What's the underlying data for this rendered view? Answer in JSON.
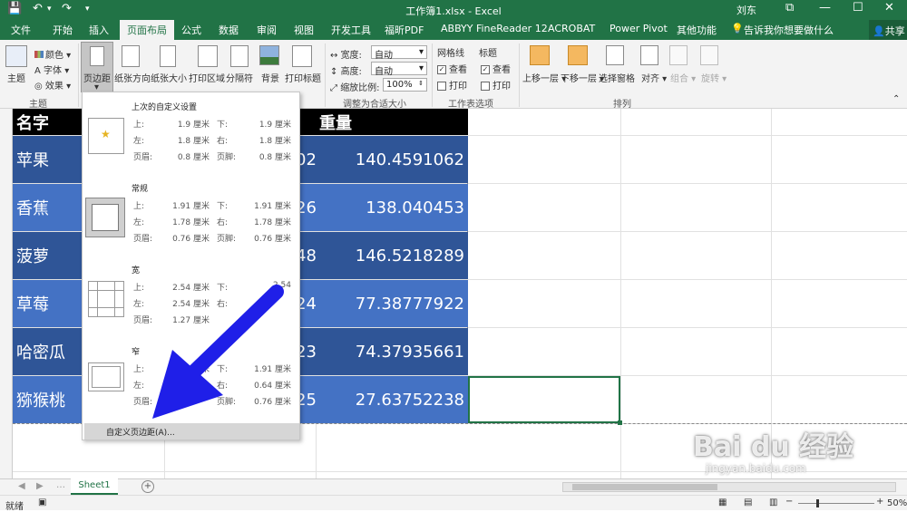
{
  "window": {
    "title": "工作簿1.xlsx - Excel",
    "user": "刘东",
    "share": "共享"
  },
  "qat": {
    "save": "💾",
    "undo": "↶",
    "undo_dd": "▾",
    "redo": "↷",
    "more": "▾"
  },
  "winctl": {
    "ribbon_opts": "⧉",
    "min": "—",
    "max": "☐",
    "close": "✕"
  },
  "tabs": [
    "文件",
    "开始",
    "插入",
    "页面布局",
    "公式",
    "数据",
    "审阅",
    "视图",
    "开发工具",
    "福昕PDF",
    "ABBYY FineReader 12",
    "ACROBAT",
    "Power Pivot",
    "其他功能"
  ],
  "tellme": "告诉我你想要做什么",
  "ribbon": {
    "theme_group": {
      "theme": "主题",
      "colors": "颜色",
      "fonts": "字体",
      "effects": "效果",
      "label": "主题"
    },
    "setup": {
      "margins": "页边距",
      "orientation": "纸张方向",
      "size": "纸张大小",
      "print_area": "打印区域",
      "breaks": "分隔符",
      "background": "背景",
      "print_titles": "打印标题"
    },
    "scale": {
      "width_label": "宽度:",
      "width_val": "自动",
      "height_label": "高度:",
      "height_val": "自动",
      "scale_label": "缩放比例:",
      "scale_val": "100%",
      "group": "调整为合适大小"
    },
    "sheet_opts": {
      "gridlines": "网格线",
      "headings": "标题",
      "view": "查看",
      "print": "打印",
      "group": "工作表选项"
    },
    "arrange": {
      "forward": "上移一层",
      "backward": "下移一层",
      "pane": "选择窗格",
      "align": "对齐",
      "group": "组合",
      "rotate": "旋转",
      "label": "排列"
    }
  },
  "table": {
    "header_name": "名字",
    "header_weight": "重量",
    "rows": [
      {
        "name": "苹果",
        "mid": "02",
        "weight": "140.4591062"
      },
      {
        "name": "香蕉",
        "mid": "26",
        "weight": "138.040453"
      },
      {
        "name": "菠萝",
        "mid": "48",
        "weight": "146.5218289"
      },
      {
        "name": "草莓",
        "mid": "24",
        "weight": "77.38777922"
      },
      {
        "name": "哈密瓜",
        "mid": "23",
        "weight": "74.37935661"
      },
      {
        "name": "猕猴桃",
        "mid": "25",
        "weight": "27.63752238"
      }
    ]
  },
  "menu": {
    "presets": [
      {
        "title": "上次的自定义设置",
        "top": "上:",
        "top_v": "1.9 厘米",
        "bottom": "下:",
        "bottom_v": "1.9 厘米",
        "left": "左:",
        "left_v": "1.8 厘米",
        "right": "右:",
        "right_v": "1.8 厘米",
        "header": "页眉:",
        "header_v": "0.8 厘米",
        "footer": "页脚:",
        "footer_v": "0.8 厘米"
      },
      {
        "title": "常规",
        "top": "上:",
        "top_v": "1.91 厘米",
        "bottom": "下:",
        "bottom_v": "1.91 厘米",
        "left": "左:",
        "left_v": "1.78 厘米",
        "right": "右:",
        "right_v": "1.78 厘米",
        "header": "页眉:",
        "header_v": "0.76 厘米",
        "footer": "页脚:",
        "footer_v": "0.76 厘米"
      },
      {
        "title": "宽",
        "top": "上:",
        "top_v": "2.54 厘米",
        "bottom": "下:",
        "bottom_v": "2.54",
        "left": "左:",
        "left_v": "2.54 厘米",
        "right": "右:",
        "right_v": "",
        "header": "页眉:",
        "header_v": "1.27 厘米",
        "footer": "页脚:",
        "footer_v": ""
      },
      {
        "title": "窄",
        "top": "上:",
        "top_v": "1.91 厘米",
        "bottom": "下:",
        "bottom_v": "1.91 厘米",
        "left": "左:",
        "left_v": "",
        "right": "右:",
        "right_v": "0.64 厘米",
        "header": "页眉:",
        "header_v": "",
        "footer": "页脚:",
        "footer_v": "0.76 厘米"
      }
    ],
    "custom": "自定义页边距(A)..."
  },
  "sheet_tab": "Sheet1",
  "add_sheet": "+",
  "status": {
    "ready": "就绪",
    "zoom": "50%"
  },
  "watermark": {
    "brand": "Bai du 经验",
    "url": "jingyan.baidu.com"
  },
  "colors": {
    "excel_green": "#217346",
    "row_dark": "#2f5597",
    "row_light": "#4472c4",
    "arrow": "#1f1fe8",
    "header_black": "#000000"
  }
}
